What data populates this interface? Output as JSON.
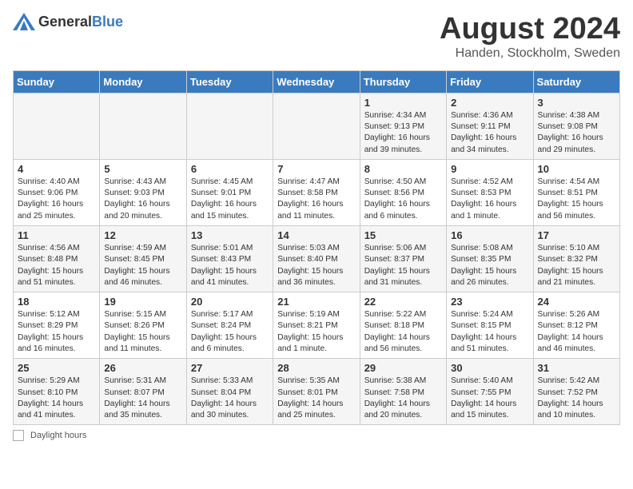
{
  "header": {
    "logo_general": "General",
    "logo_blue": "Blue",
    "month_title": "August 2024",
    "location": "Handen, Stockholm, Sweden"
  },
  "weekdays": [
    "Sunday",
    "Monday",
    "Tuesday",
    "Wednesday",
    "Thursday",
    "Friday",
    "Saturday"
  ],
  "weeks": [
    [
      {
        "day": "",
        "info": ""
      },
      {
        "day": "",
        "info": ""
      },
      {
        "day": "",
        "info": ""
      },
      {
        "day": "",
        "info": ""
      },
      {
        "day": "1",
        "info": "Sunrise: 4:34 AM\nSunset: 9:13 PM\nDaylight: 16 hours\nand 39 minutes."
      },
      {
        "day": "2",
        "info": "Sunrise: 4:36 AM\nSunset: 9:11 PM\nDaylight: 16 hours\nand 34 minutes."
      },
      {
        "day": "3",
        "info": "Sunrise: 4:38 AM\nSunset: 9:08 PM\nDaylight: 16 hours\nand 29 minutes."
      }
    ],
    [
      {
        "day": "4",
        "info": "Sunrise: 4:40 AM\nSunset: 9:06 PM\nDaylight: 16 hours\nand 25 minutes."
      },
      {
        "day": "5",
        "info": "Sunrise: 4:43 AM\nSunset: 9:03 PM\nDaylight: 16 hours\nand 20 minutes."
      },
      {
        "day": "6",
        "info": "Sunrise: 4:45 AM\nSunset: 9:01 PM\nDaylight: 16 hours\nand 15 minutes."
      },
      {
        "day": "7",
        "info": "Sunrise: 4:47 AM\nSunset: 8:58 PM\nDaylight: 16 hours\nand 11 minutes."
      },
      {
        "day": "8",
        "info": "Sunrise: 4:50 AM\nSunset: 8:56 PM\nDaylight: 16 hours\nand 6 minutes."
      },
      {
        "day": "9",
        "info": "Sunrise: 4:52 AM\nSunset: 8:53 PM\nDaylight: 16 hours\nand 1 minute."
      },
      {
        "day": "10",
        "info": "Sunrise: 4:54 AM\nSunset: 8:51 PM\nDaylight: 15 hours\nand 56 minutes."
      }
    ],
    [
      {
        "day": "11",
        "info": "Sunrise: 4:56 AM\nSunset: 8:48 PM\nDaylight: 15 hours\nand 51 minutes."
      },
      {
        "day": "12",
        "info": "Sunrise: 4:59 AM\nSunset: 8:45 PM\nDaylight: 15 hours\nand 46 minutes."
      },
      {
        "day": "13",
        "info": "Sunrise: 5:01 AM\nSunset: 8:43 PM\nDaylight: 15 hours\nand 41 minutes."
      },
      {
        "day": "14",
        "info": "Sunrise: 5:03 AM\nSunset: 8:40 PM\nDaylight: 15 hours\nand 36 minutes."
      },
      {
        "day": "15",
        "info": "Sunrise: 5:06 AM\nSunset: 8:37 PM\nDaylight: 15 hours\nand 31 minutes."
      },
      {
        "day": "16",
        "info": "Sunrise: 5:08 AM\nSunset: 8:35 PM\nDaylight: 15 hours\nand 26 minutes."
      },
      {
        "day": "17",
        "info": "Sunrise: 5:10 AM\nSunset: 8:32 PM\nDaylight: 15 hours\nand 21 minutes."
      }
    ],
    [
      {
        "day": "18",
        "info": "Sunrise: 5:12 AM\nSunset: 8:29 PM\nDaylight: 15 hours\nand 16 minutes."
      },
      {
        "day": "19",
        "info": "Sunrise: 5:15 AM\nSunset: 8:26 PM\nDaylight: 15 hours\nand 11 minutes."
      },
      {
        "day": "20",
        "info": "Sunrise: 5:17 AM\nSunset: 8:24 PM\nDaylight: 15 hours\nand 6 minutes."
      },
      {
        "day": "21",
        "info": "Sunrise: 5:19 AM\nSunset: 8:21 PM\nDaylight: 15 hours\nand 1 minute."
      },
      {
        "day": "22",
        "info": "Sunrise: 5:22 AM\nSunset: 8:18 PM\nDaylight: 14 hours\nand 56 minutes."
      },
      {
        "day": "23",
        "info": "Sunrise: 5:24 AM\nSunset: 8:15 PM\nDaylight: 14 hours\nand 51 minutes."
      },
      {
        "day": "24",
        "info": "Sunrise: 5:26 AM\nSunset: 8:12 PM\nDaylight: 14 hours\nand 46 minutes."
      }
    ],
    [
      {
        "day": "25",
        "info": "Sunrise: 5:29 AM\nSunset: 8:10 PM\nDaylight: 14 hours\nand 41 minutes."
      },
      {
        "day": "26",
        "info": "Sunrise: 5:31 AM\nSunset: 8:07 PM\nDaylight: 14 hours\nand 35 minutes."
      },
      {
        "day": "27",
        "info": "Sunrise: 5:33 AM\nSunset: 8:04 PM\nDaylight: 14 hours\nand 30 minutes."
      },
      {
        "day": "28",
        "info": "Sunrise: 5:35 AM\nSunset: 8:01 PM\nDaylight: 14 hours\nand 25 minutes."
      },
      {
        "day": "29",
        "info": "Sunrise: 5:38 AM\nSunset: 7:58 PM\nDaylight: 14 hours\nand 20 minutes."
      },
      {
        "day": "30",
        "info": "Sunrise: 5:40 AM\nSunset: 7:55 PM\nDaylight: 14 hours\nand 15 minutes."
      },
      {
        "day": "31",
        "info": "Sunrise: 5:42 AM\nSunset: 7:52 PM\nDaylight: 14 hours\nand 10 minutes."
      }
    ]
  ],
  "footer": {
    "legend_label": "Daylight hours"
  }
}
